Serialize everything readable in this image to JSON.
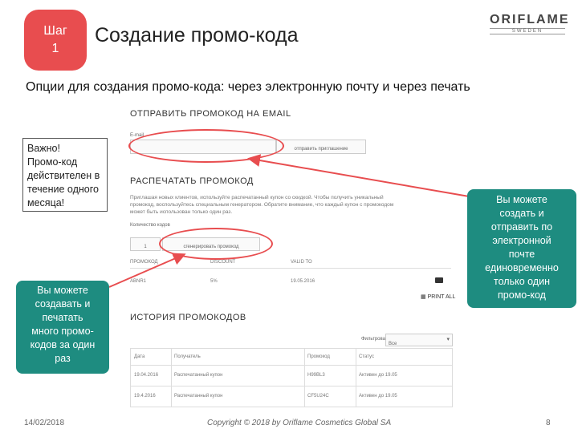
{
  "header": {
    "step_line1": "Шаг",
    "step_line2": "1",
    "title": "Создание промо-кода",
    "logo_brand": "ORIFLAME",
    "logo_sub": "SWEDEN",
    "subtitle": "Опции для создания промо-кода: через электронную почту и через печать"
  },
  "panel": {
    "email_section_title": "ОТПРАВИТЬ ПРОМОКОД НА EMAIL",
    "email_label": "E-mail",
    "email_value": "",
    "send_button": "отправить приглашение",
    "print_section_title": "РАСПЕЧАТАТЬ ПРОМОКОД",
    "print_text_1": "Приглашая новых клиентов, используйте распечатанный купон со скидкой. Чтобы получить уникальный",
    "print_text_2": "промокод, воспользуйтесь специальным генератором. Обратите внимание, что каждый купон с промокодом",
    "print_text_3": "может быть использован только один раз.",
    "quantity_label": "Количество кодов",
    "quantity_value": "1",
    "generate_button": "сгенерировать промокод",
    "codes_headers": [
      "ПРОМОКОД",
      "DISCOUNT",
      "VALID TO"
    ],
    "codes_row": [
      "ABNR1",
      "5%",
      "19.05.2016"
    ],
    "print_all": "PRINT ALL",
    "history_title": "ИСТОРИЯ ПРОМОКОДОВ",
    "filter_label": "Фильтровать",
    "filter_value": "Все",
    "history_headers": [
      "Дата",
      "Получатель",
      "Промокод",
      "Статус"
    ],
    "history_rows": [
      [
        "19.04.2016",
        "Распечатанный купон",
        "H99BL3",
        "Активен до 19.05"
      ],
      [
        "19.4.2016",
        "Распечатанный купон",
        "CF5U24C",
        "Активен до 19.05"
      ]
    ]
  },
  "callouts": {
    "important_1": "Важно!",
    "important_2": "Промо-код",
    "important_3": "действителен в",
    "important_4": "течение одного",
    "important_5": "месяца!",
    "left_1": "Вы можете",
    "left_2": "создавать и",
    "left_3": "печатать",
    "left_4": "много промо-",
    "left_5": "кодов за один",
    "left_6": "раз",
    "right_1": "Вы можете",
    "right_2": "создать и",
    "right_3": "отправить по",
    "right_4": "электронной",
    "right_5": "почте",
    "right_6": "единовременно",
    "right_7": "только один",
    "right_8": "промо-код"
  },
  "footer": {
    "date": "14/02/2018",
    "copyright": "Copyright © 2018 by Oriflame Cosmetics Global SA",
    "page": "8"
  },
  "colors": {
    "accent_red": "#e84d4f",
    "callout_teal": "#1e8c80"
  }
}
